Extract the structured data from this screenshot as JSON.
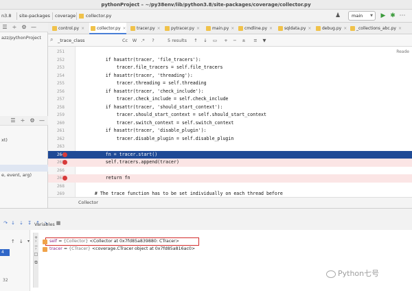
{
  "window": {
    "title": "pythonProject – ~/py38env/lib/python3.8/site-packages/coverage/collector.py"
  },
  "breadcrumbs": [
    "n3.8",
    "site-packages",
    "coverage",
    "collector.py"
  ],
  "vcs": {
    "branch": "main"
  },
  "project": {
    "path_label": "azz/pythonProject"
  },
  "tabs": [
    {
      "label": "control.py",
      "active": false
    },
    {
      "label": "collector.py",
      "active": true
    },
    {
      "label": "tracer.py",
      "active": false
    },
    {
      "label": "pytracer.py",
      "active": false
    },
    {
      "label": "main.py",
      "active": false
    },
    {
      "label": "cmdline.py",
      "active": false
    },
    {
      "label": "sqldata.py",
      "active": false
    },
    {
      "label": "debug.py",
      "active": false
    },
    {
      "label": "_collections_abc.py",
      "active": false
    }
  ],
  "search": {
    "query": "_trace_class",
    "match_case": "Cc",
    "whole_word": "W",
    "regex": ".*",
    "help": "?",
    "results": "5 results"
  },
  "editor": {
    "reader_mode": "Reade",
    "lines": [
      {
        "num": "251",
        "text": "",
        "style": "",
        "bp": false
      },
      {
        "num": "252",
        "text": "        if hasattr(tracer, 'file_tracers'):",
        "style": "",
        "bp": false
      },
      {
        "num": "253",
        "text": "            tracer.file_tracers = self.file_tracers",
        "style": "",
        "bp": false
      },
      {
        "num": "254",
        "text": "        if hasattr(tracer, 'threading'):",
        "style": "",
        "bp": false
      },
      {
        "num": "255",
        "text": "            tracer.threading = self.threading",
        "style": "",
        "bp": false
      },
      {
        "num": "256",
        "text": "        if hasattr(tracer, 'check_include'):",
        "style": "",
        "bp": false
      },
      {
        "num": "257",
        "text": "            tracer.check_include = self.check_include",
        "style": "",
        "bp": false
      },
      {
        "num": "258",
        "text": "        if hasattr(tracer, 'should_start_context'):",
        "style": "",
        "bp": false
      },
      {
        "num": "259",
        "text": "            tracer.should_start_context = self.should_start_context",
        "style": "",
        "bp": false
      },
      {
        "num": "260",
        "text": "            tracer.switch_context = self.switch_context",
        "style": "",
        "bp": false
      },
      {
        "num": "261",
        "text": "        if hasattr(tracer, 'disable_plugin'):",
        "style": "",
        "bp": false
      },
      {
        "num": "262",
        "text": "            tracer.disable_plugin = self.disable_plugin",
        "style": "",
        "bp": false
      },
      {
        "num": "263",
        "text": "",
        "style": "",
        "bp": false
      },
      {
        "num": "264",
        "text": "        fn = tracer.start()",
        "style": "blue",
        "bp": true
      },
      {
        "num": "265",
        "text": "        self.tracers.append(tracer)",
        "style": "pink",
        "bp": true
      },
      {
        "num": "266",
        "text": "",
        "style": "",
        "bp": false
      },
      {
        "num": "267",
        "text": "        return fn",
        "style": "pink",
        "bp": true
      },
      {
        "num": "268",
        "text": "",
        "style": "",
        "bp": false
      },
      {
        "num": "269",
        "text": "    # The trace function has to be set individually on each thread before",
        "style": "",
        "bp": false
      }
    ]
  },
  "code_breadcrumb": "Collector",
  "left_panel": {
    "frame_text_1": "xt)",
    "frame_text_2": "e, event, arg)"
  },
  "debugger": {
    "variables_label": "Variables",
    "frame_selected": "4",
    "frame_bottom": "32",
    "variables": [
      {
        "name": "self",
        "eq": " = ",
        "type": "{Collector}",
        "value": " <Collector at 0x7fd85a839880: CTracer>"
      },
      {
        "name": "tracer",
        "eq": " = ",
        "type": "{CTracer}",
        "value": " <coverage.CTracer object at 0x7fd85a816ac0>"
      }
    ]
  },
  "watermark": {
    "text": "Python七号"
  },
  "colors": {
    "accent": "#1f4a96",
    "breakpoint": "#d73a3a",
    "highlight_box": "#d22b2b"
  }
}
